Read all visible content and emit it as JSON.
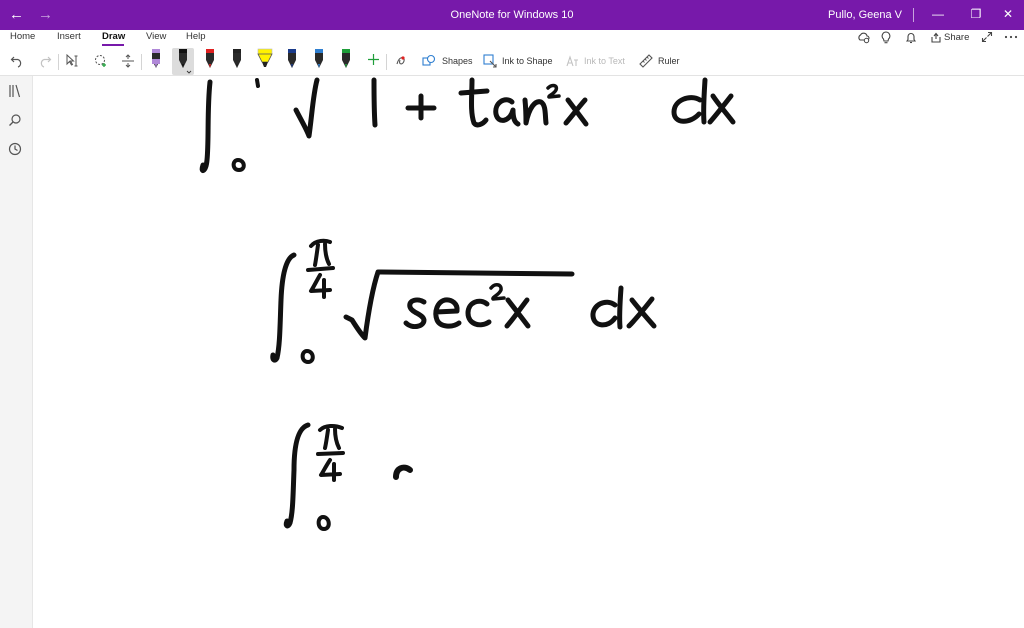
{
  "titlebar": {
    "back_glyph": "←",
    "forward_glyph": "→",
    "app_title": "OneNote for Windows 10",
    "user_name": "Pullo, Geena V",
    "minimize_glyph": "—",
    "restore_glyph": "❐",
    "close_glyph": "✕",
    "background_color": "#7719aa"
  },
  "ribbon": {
    "tabs": [
      {
        "label": "Home"
      },
      {
        "label": "Insert"
      },
      {
        "label": "Draw",
        "active": true
      },
      {
        "label": "View"
      },
      {
        "label": "Help"
      }
    ],
    "share_label": "Share",
    "accent_color": "#7719aa",
    "right_icons": [
      "sync-status-icon",
      "lightbulb-icon",
      "bell-icon",
      "share-icon",
      "expand-icon",
      "more-icon"
    ]
  },
  "toolbar": {
    "shapes_label": "Shapes",
    "ink_to_shape_label": "Ink to Shape",
    "ink_to_text_label": "Ink to Text",
    "ruler_label": "Ruler",
    "pens": [
      {
        "name": "purple-pen",
        "color": "#b088d8",
        "kind": "pen"
      },
      {
        "name": "black-pen",
        "color": "#111111",
        "kind": "pen",
        "selected": true
      },
      {
        "name": "red-pen",
        "color": "#e02020",
        "kind": "pen"
      },
      {
        "name": "dark-pen",
        "color": "#222222",
        "kind": "pen"
      },
      {
        "name": "yellow-highlighter",
        "color": "#fff200",
        "kind": "highlighter"
      },
      {
        "name": "navy-pen",
        "color": "#1a3b8a",
        "kind": "pen"
      },
      {
        "name": "blue-pen",
        "color": "#2f7fd0",
        "kind": "pen"
      },
      {
        "name": "green-pen",
        "color": "#1f9e3a",
        "kind": "pen"
      }
    ]
  },
  "sidebar": {
    "icons": [
      "notebooks-icon",
      "search-icon",
      "recent-icon"
    ]
  },
  "canvas": {
    "ink_color": "#111111",
    "content": "handwritten integrals"
  }
}
